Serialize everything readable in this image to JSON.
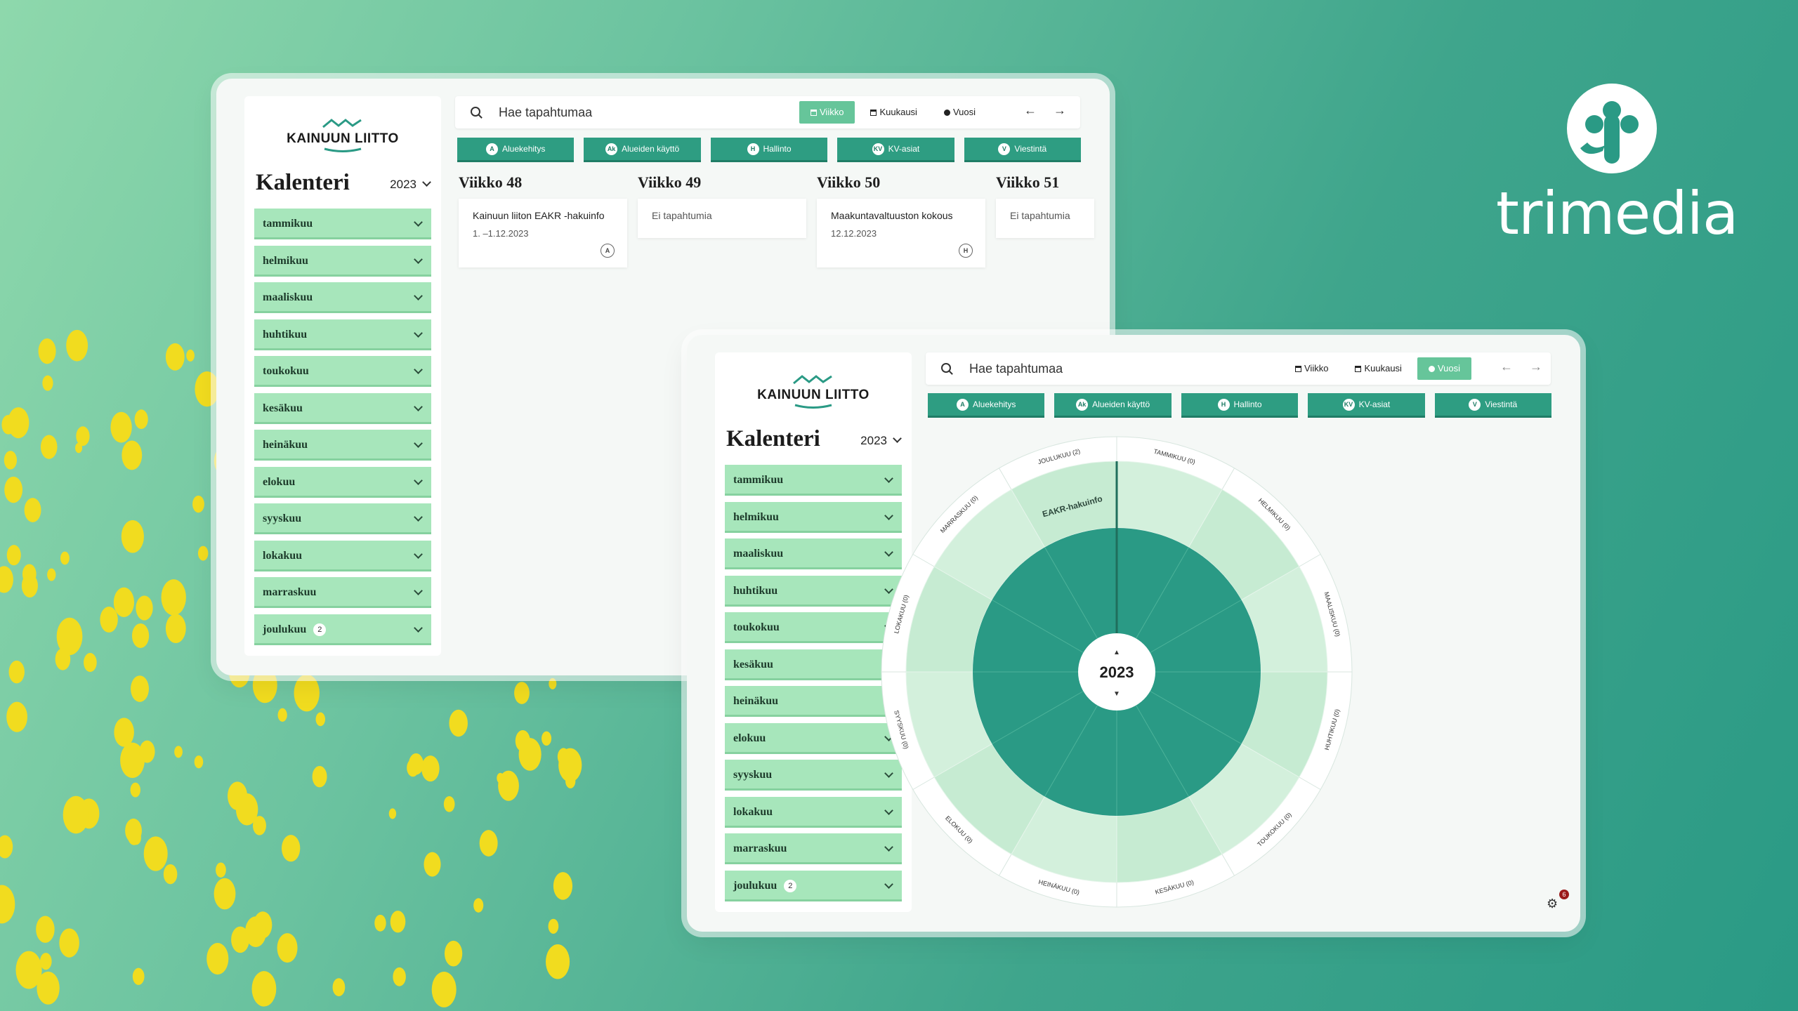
{
  "brand": {
    "trimedia": "trimedia",
    "kainuun": "KAINUUN LIITTO",
    "primary": "#2a9a85",
    "accent": "#a7e6bb"
  },
  "sidebar": {
    "title": "Kalenteri",
    "year": "2023",
    "months": [
      {
        "label": "tammikuu"
      },
      {
        "label": "helmikuu"
      },
      {
        "label": "maaliskuu"
      },
      {
        "label": "huhtikuu"
      },
      {
        "label": "toukokuu"
      },
      {
        "label": "kesäkuu"
      },
      {
        "label": "heinäkuu"
      },
      {
        "label": "elokuu"
      },
      {
        "label": "syyskuu"
      },
      {
        "label": "lokakuu"
      },
      {
        "label": "marraskuu"
      },
      {
        "label": "joulukuu",
        "badge": "2"
      }
    ]
  },
  "search": {
    "placeholder": "Hae tapahtumaa"
  },
  "views": {
    "week": "Viikko",
    "month": "Kuukausi",
    "year": "Vuosi",
    "prev": "←",
    "next": "→"
  },
  "categories": [
    {
      "label": "Aluekehitys",
      "icon": "A"
    },
    {
      "label": "Alueiden käyttö",
      "icon": "Ak"
    },
    {
      "label": "Hallinto",
      "icon": "H"
    },
    {
      "label": "KV-asiat",
      "icon": "KV"
    },
    {
      "label": "Viestintä",
      "icon": "V"
    }
  ],
  "weeks": [
    {
      "title": "Viikko 48",
      "event": "Kainuun liiton EAKR -hakuinfo",
      "date": "1. –1.12.2023",
      "mark": "A"
    },
    {
      "title": "Viikko 49",
      "empty": "Ei tapahtumia"
    },
    {
      "title": "Viikko 50",
      "event": "Maakuntavaltuuston kokous",
      "date": "12.12.2023",
      "mark": "H"
    },
    {
      "title": "Viikko 51",
      "empty": "Ei tapahtumia"
    }
  ],
  "wheel": {
    "year": "2023",
    "months": [
      "TAMMIKUU (0)",
      "HELMIKUU (0)",
      "MAALISKUU (0)",
      "HUHTIKUU (0)",
      "TOUKOKUU (0)",
      "KESÄKUU (0)",
      "HEINÄKUU (0)",
      "ELOKUU (0)",
      "SYYSKUU (0)",
      "LOKAKUU (0)",
      "MARRASKUU (0)",
      "JOULUKUU (2)"
    ],
    "event": "EAKR-hakuinfo"
  },
  "notifications": {
    "count": "6"
  }
}
